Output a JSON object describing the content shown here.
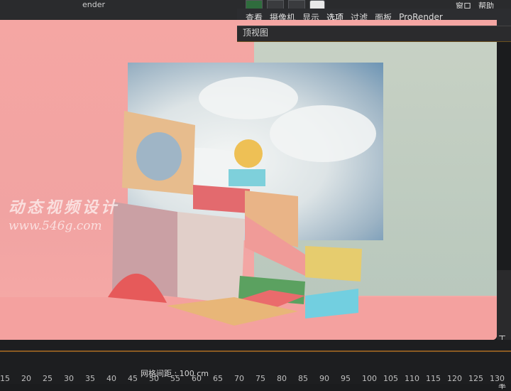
{
  "app": {
    "title_fragment": "ender"
  },
  "menubar": {
    "items": [
      "查看",
      "摄像机",
      "显示",
      "选项",
      "过滤",
      "面板",
      "ProRender"
    ],
    "active_index": 3
  },
  "top_right_menu": [
    "窗口",
    "帮助"
  ],
  "viewport": {
    "title": "顶视图"
  },
  "status": {
    "grid_spacing": "网格间距 : 100 cm"
  },
  "timeline": {
    "ticks": [
      "15",
      "20",
      "25",
      "30",
      "35",
      "40",
      "45",
      "50",
      "55",
      "60",
      "65",
      "70",
      "75",
      "80",
      "85",
      "90",
      "95",
      "100",
      "105",
      "110",
      "115",
      "120",
      "125",
      "130"
    ]
  },
  "side_panel": {
    "labels": [
      "工程",
      "工",
      "帧率"
    ]
  },
  "watermark": {
    "line1": "动态视频设计",
    "line2": "www.546g.com"
  },
  "colors": {
    "accent_orange": "#ffa500",
    "scene_pink": "#f4a19f",
    "scene_teal": "#bfcbc0"
  }
}
